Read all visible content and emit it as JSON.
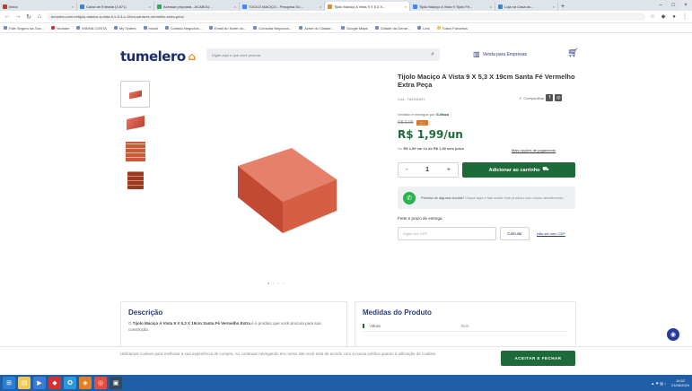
{
  "browser": {
    "tabs": [
      {
        "label": "Inbox",
        "color": "#c0392b"
      },
      {
        "label": "Caixa de Entrada (3.671)",
        "color": "#2e86de"
      },
      {
        "label": "Acessar proposta - ACABOU...",
        "color": "#27ae60"
      },
      {
        "label": "TIJOLO MACIÇO - Pesquisa Go...",
        "color": "#4285f4"
      },
      {
        "label": "Tijolo Maciço A Vista 9 X 5,3 X...",
        "color": "#f28a1a"
      },
      {
        "label": "Tijolo Maciço A Vista 9 Tijolo Fé...",
        "color": "#4285f4"
      },
      {
        "label": "Loja na Casa do...",
        "color": "#2e86de"
      }
    ],
    "url": "tumelero.com.br/tijolo-macico-a-vista-9-x-5-3-x-19cm-santa-fe-vermelho-extra-peca",
    "bookmarks": [
      "Fale Seguro na Gov...",
      "Youtube",
      "MINHA CONTA",
      "My Orders",
      "Inicial",
      "Contato Negocios...",
      "Email do Norte do...",
      "Consulta Negocios...",
      "Achei do Cidade...",
      "Google Maps",
      "Cidade da Gente...",
      "Link",
      "Todos Favoritos"
    ]
  },
  "header": {
    "logo": "tumelero",
    "search_placeholder": "Digite aqui o que você procura",
    "vender_label": "Venda para Empresas",
    "icons": {
      "search": "search-icon",
      "cart": "cart-icon",
      "building": "building-icon"
    }
  },
  "product": {
    "title": "Tijolo Maciço A Vista 9 X 5,3 X 19cm Santa Fé Vermelho Extra Peça",
    "code": "Cód.: 764391897",
    "share_label": "Compartilhar",
    "sold_by_prefix": "Vendido e entregue por",
    "sold_by": "G-Maza",
    "old_price": "R$ 2,09",
    "discount_badge": "-5%",
    "price": "R$ 1,99/un",
    "installments_prefix": "Ou",
    "installments_value": "R$ 1,99 em 1x de R$ 1,99 sem juros",
    "payment_options": "Mais opções de pagamento",
    "quantity": "1",
    "qty_minus": "-",
    "qty_plus": "+",
    "add_to_cart": "Adicionar ao carrinho",
    "whatsapp_title": "Precisa de alguma dúvida?",
    "whatsapp_text": "Clique aqui e fale sobre este produto com nosso atendimento.",
    "shipping_label": "Frete e prazo de entrega",
    "cep_placeholder": "Digite seu CEP",
    "calc_button": "Calcular",
    "dont_know_cep": "Não sei meu CEP",
    "gallery_dots": "● ○ ○ ○"
  },
  "description": {
    "title": "Descrição",
    "text_prefix": "O",
    "text_bold": "Tijolo Maciço A Vista 9 X 5,3 X 19cm Santa Fé Vermelho Extra",
    "text_rest": "é o produto que você procura para sua construção."
  },
  "measures": {
    "title": "Medidas do Produto",
    "rows": [
      {
        "k": "Altura",
        "v": "9cm"
      }
    ]
  },
  "cookie": {
    "text": "Utilizamos cookies para melhorar a sua experiência de compra. Ao continuar navegando em nosso site você está de acordo com a nossa política quanto à utilização de cookies.",
    "button": "ACEITAR E FECHAR"
  },
  "taskbar": {
    "time": "14:52",
    "date": "21/06/2024"
  }
}
